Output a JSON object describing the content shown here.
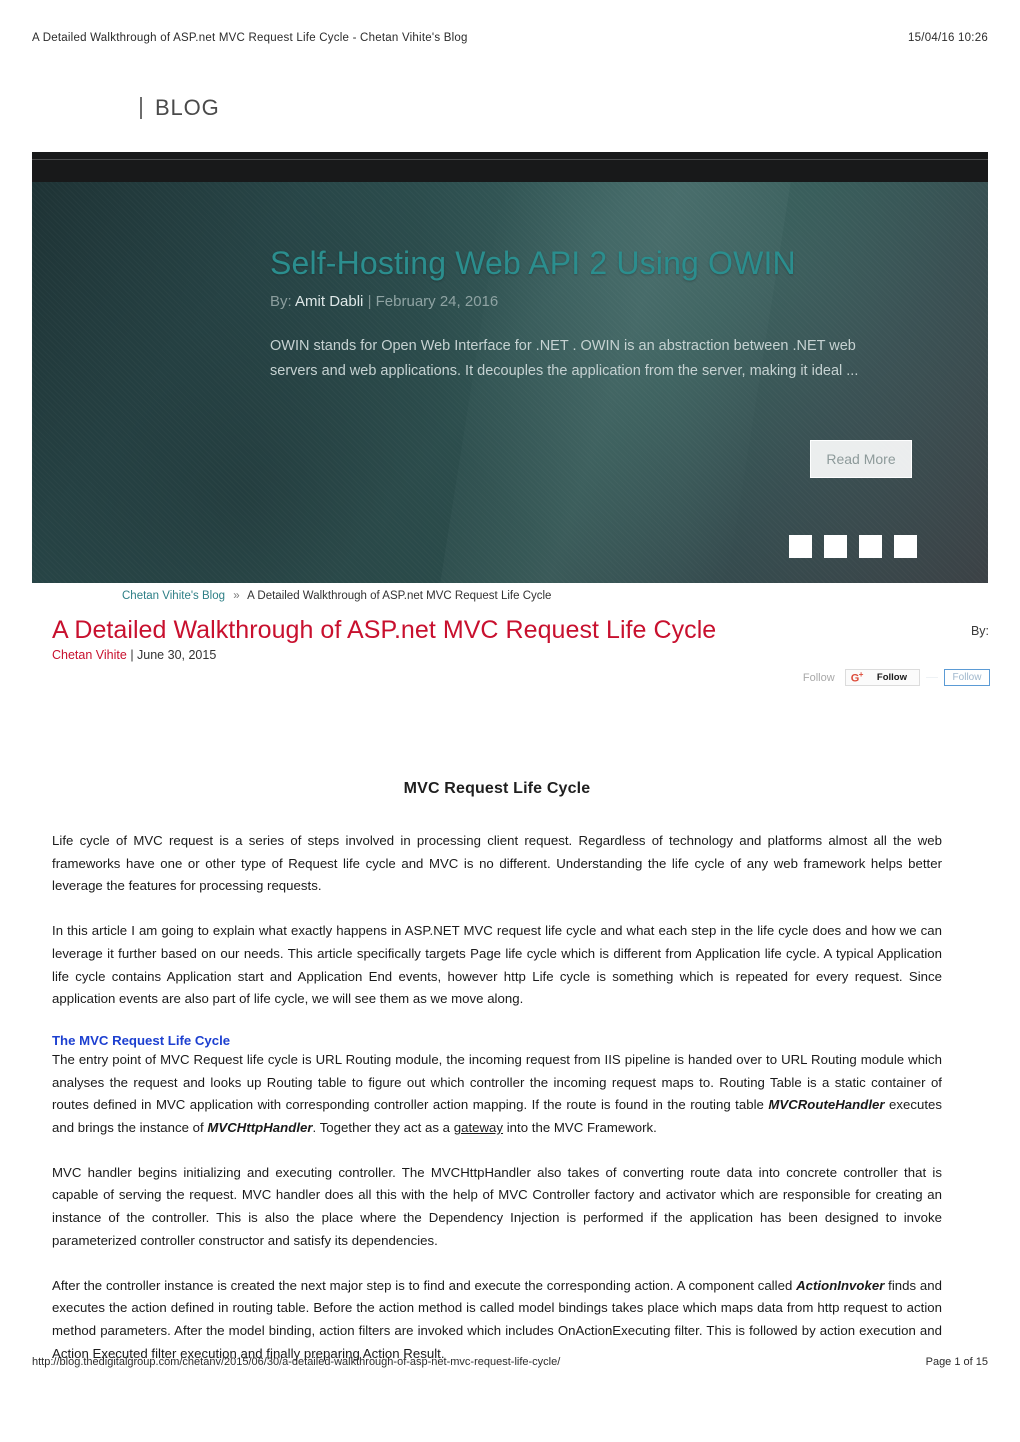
{
  "print_header": {
    "title": "A Detailed Walkthrough of ASP.net MVC Request Life Cycle - Chetan Vihite's Blog",
    "date": "15/04/16 10:26"
  },
  "logo": {
    "text": "BLOG"
  },
  "hero": {
    "title": "Self-Hosting Web API 2 Using OWIN",
    "by_label": "By:",
    "author": "Amit Dabli",
    "separator": "|",
    "date": "February 24, 2016",
    "excerpt": "OWIN stands for Open Web Interface for .NET . OWIN is an abstraction between .NET web servers and web applications. It decouples the application from the server, making it ideal ...",
    "read_more": "Read More",
    "slide_count": 4,
    "title_color": "#2b8e8e"
  },
  "breadcrumb": {
    "home": "Chetan Vihite's Blog",
    "separator": "»",
    "current": "A Detailed Walkthrough of ASP.net MVC Request Life Cycle"
  },
  "post": {
    "title": "A Detailed Walkthrough of ASP.net MVC Request Life Cycle",
    "title_color": "#c8102e",
    "author": "Chetan Vihite",
    "meta_separator_date": "| June 30, 2015",
    "by_label": "By:"
  },
  "social": {
    "follow_plain": "Follow",
    "gplus_icon": "G+",
    "gplus_label": "Follow",
    "follow_outline": "Follow"
  },
  "article": {
    "heading": "MVC Request Life Cycle",
    "paragraph_1": "Life cycle of MVC request is a series of steps involved in processing client request. Regardless of technology and platforms almost all the web frameworks have one or other type of Request life cycle and MVC is no different. Understanding the life cycle of any web framework helps better leverage the features for processing requests.",
    "paragraph_2": "In this article I am going to explain what exactly happens in ASP.NET MVC request life cycle and what each step in the life cycle does and how we can leverage it further based on our needs. This article specifically targets Page life cycle which is different from Application life cycle. A typical Application life cycle contains Application start and Application End events, however http Life cycle is something which is repeated for every request. Since application events are also part of life cycle, we will see them as we move along.",
    "sub_heading": "The MVC Request Life Cycle",
    "sub_heading_color": "#1c3fd0",
    "paragraph_3_a": "The entry point of MVC Request life cycle is URL Routing module, the incoming request from IIS pipeline is handed over to URL Routing module which analyses the request and looks up Routing table to figure out which controller the incoming request maps to. Routing Table is a static container of routes defined in MVC application with corresponding controller action mapping. If the route is found in the routing table ",
    "paragraph_3_em1": "MVCRouteHandler",
    "paragraph_3_b": " executes and brings the instance of ",
    "paragraph_3_em2": "MVCHttpHandler",
    "paragraph_3_c": ". Together they act as a ",
    "paragraph_3_underline": "gateway",
    "paragraph_3_d": " into the MVC Framework.",
    "paragraph_4": "MVC handler begins initializing and executing controller. The MVCHttpHandler also takes of converting route data into concrete controller that is capable of serving the request. MVC handler does all this with the help of MVC Controller factory and activator which are responsible for creating an instance of the controller. This is also the place where the Dependency Injection is performed if the application has been designed to invoke parameterized controller constructor and satisfy its dependencies.",
    "paragraph_5_a": "After the controller instance is created the next major step is to find and execute the corresponding action. A component called ",
    "paragraph_5_em": "ActionInvoker",
    "paragraph_5_b": " finds and executes the action defined in routing table. Before the action method is called model bindings takes place which maps data from http request to action method parameters. After the model binding, action filters are invoked which includes OnActionExecuting filter. This is followed by action execution and Action Executed filter execution and finally preparing Action Result."
  },
  "print_footer": {
    "url": "http://blog.thedigitalgroup.com/chetanv/2015/06/30/a-detailed-walkthrough-of-asp-net-mvc-request-life-cycle/",
    "page": "Page 1 of 15"
  }
}
